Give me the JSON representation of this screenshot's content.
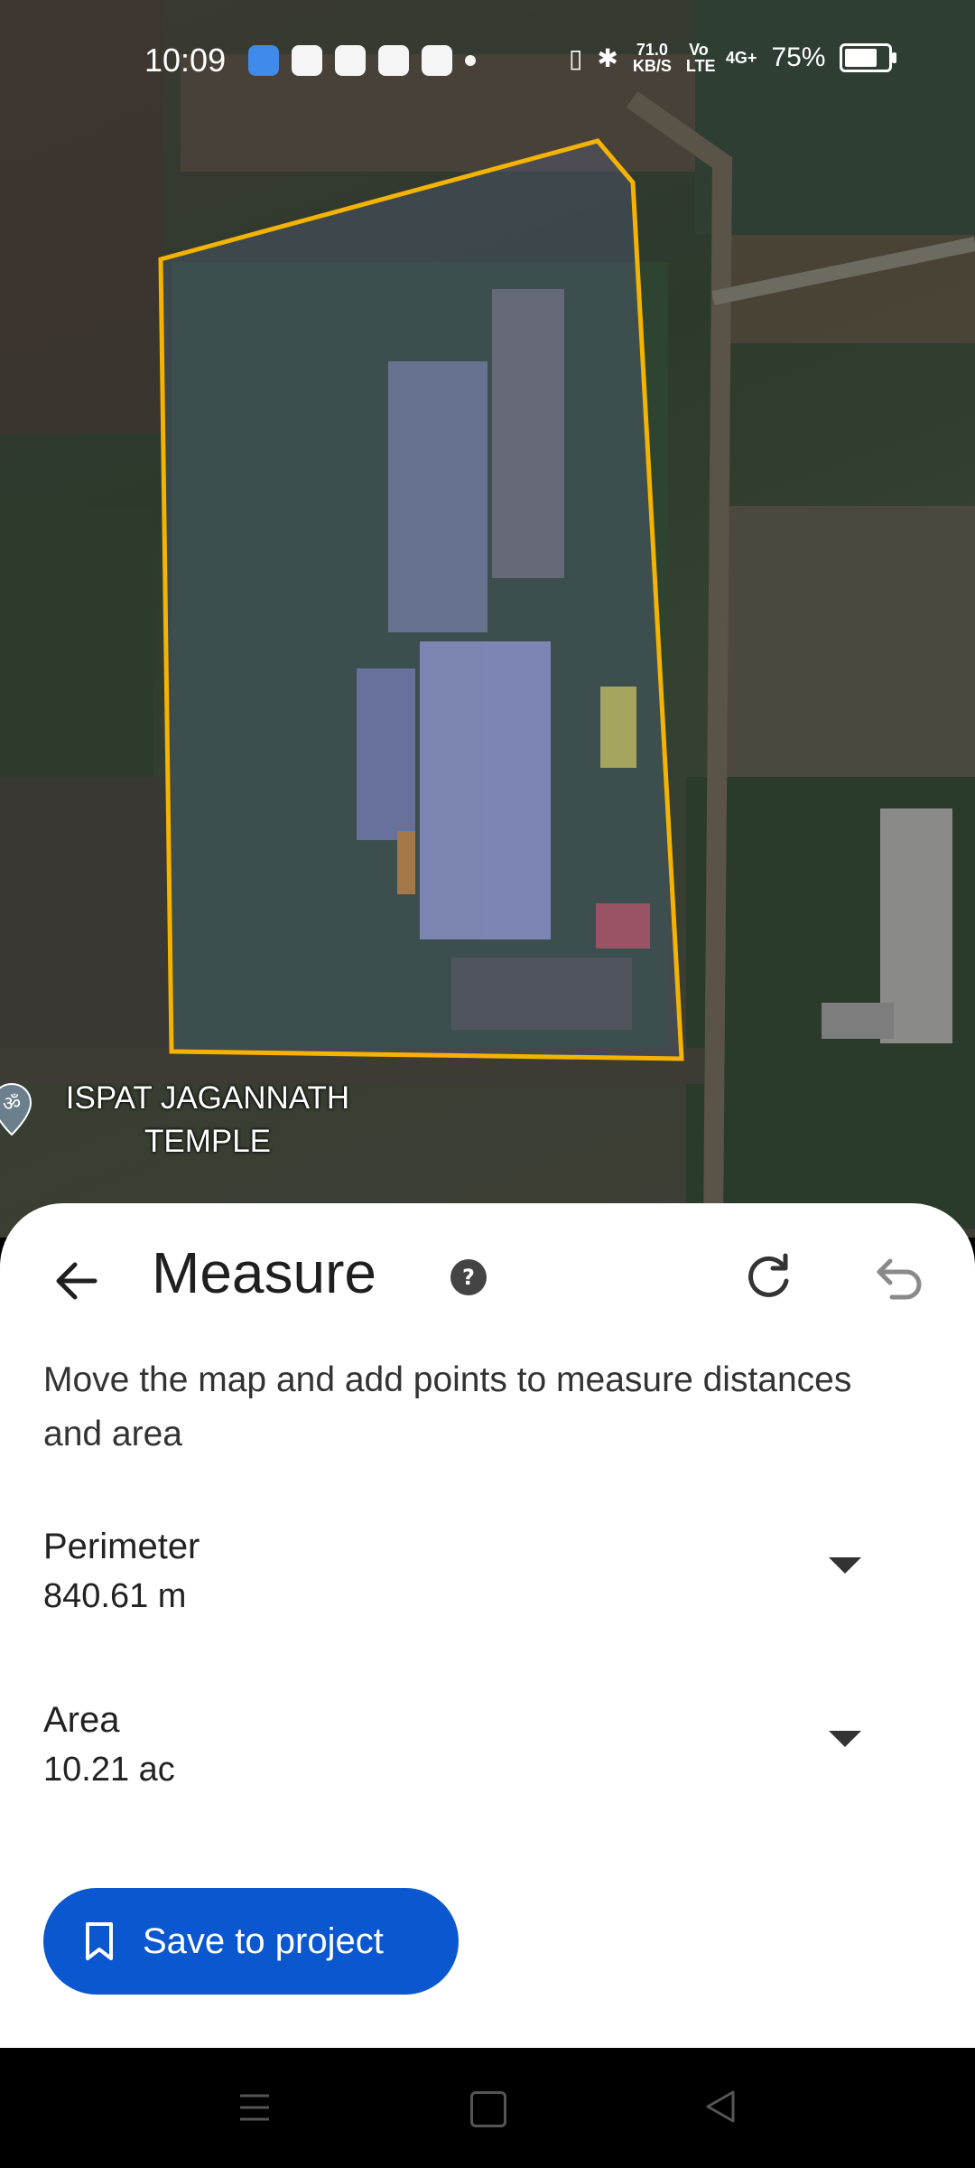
{
  "status_bar": {
    "time": "10:09",
    "net_speed_value": "71.0",
    "net_speed_unit": "KB/S",
    "volte": "Vo LTE",
    "signal": "4G+",
    "battery_percent": "75%",
    "battery_level": 0.75
  },
  "map": {
    "place_label": "ISPAT JAGANNATH TEMPLE",
    "place_icon": "om-icon",
    "polygon_color": "#f5b301"
  },
  "sheet": {
    "title": "Measure",
    "instruction": "Move the map and add points to measure distances and area",
    "perimeter": {
      "label": "Perimeter",
      "value": "840.61 m"
    },
    "area": {
      "label": "Area",
      "value": "10.21 ac"
    },
    "save_button": "Save to project",
    "accent_color": "#0b57d0"
  }
}
